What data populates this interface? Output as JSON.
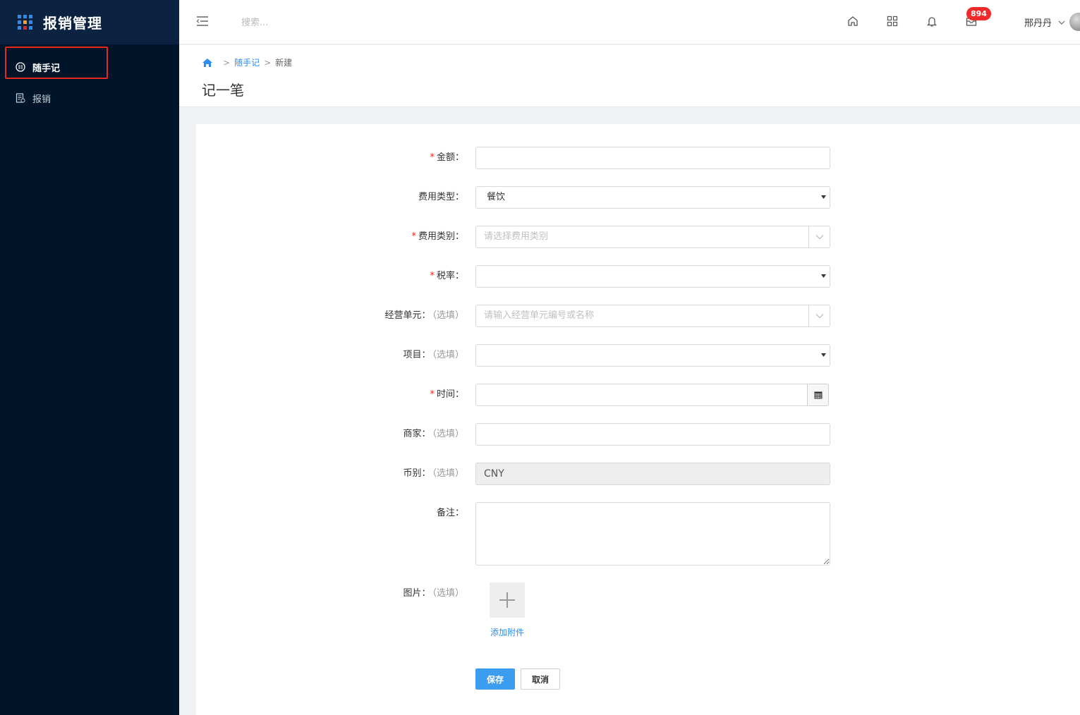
{
  "app": {
    "title": "报销管理"
  },
  "sidebar": {
    "items": [
      {
        "label": "随手记",
        "icon": "notebook-icon",
        "active": true
      },
      {
        "label": "报销",
        "icon": "receipt-icon",
        "active": false
      }
    ]
  },
  "header": {
    "search_placeholder": "搜索...",
    "notification_count": "894",
    "user_name": "邢丹丹"
  },
  "breadcrumb": {
    "level1": "随手记",
    "level2": "新建",
    "separator": ">"
  },
  "page": {
    "title": "记一笔"
  },
  "form": {
    "amount": {
      "label": "金额：",
      "value": ""
    },
    "expense_type": {
      "label": "费用类型：",
      "value": "餐饮"
    },
    "expense_category": {
      "label": "费用类别：",
      "placeholder": "请选择费用类别"
    },
    "tax_rate": {
      "label": "税率：",
      "value": ""
    },
    "business_unit": {
      "label": "经营单元：",
      "optional": "（选填）",
      "placeholder": "请输入经营单元编号或名称"
    },
    "project": {
      "label": "项目：",
      "optional": "（选填）",
      "value": ""
    },
    "time": {
      "label": "时间：",
      "value": ""
    },
    "merchant": {
      "label": "商家：",
      "optional": "（选填）",
      "value": ""
    },
    "currency": {
      "label": "币别：",
      "optional": "（选填）",
      "value": "CNY"
    },
    "remark": {
      "label": "备注：",
      "value": ""
    },
    "image": {
      "label": "图片：",
      "optional": "（选填）",
      "add_text": "添加附件"
    },
    "required_mark": "*"
  },
  "actions": {
    "save": "保存",
    "cancel": "取消"
  },
  "colors": {
    "sidebar_bg": "#001529",
    "brand_bg": "#0b2240",
    "primary": "#3b9cf0",
    "link": "#2d8cf0",
    "required": "#e8271b",
    "badge": "#f02a2a"
  }
}
